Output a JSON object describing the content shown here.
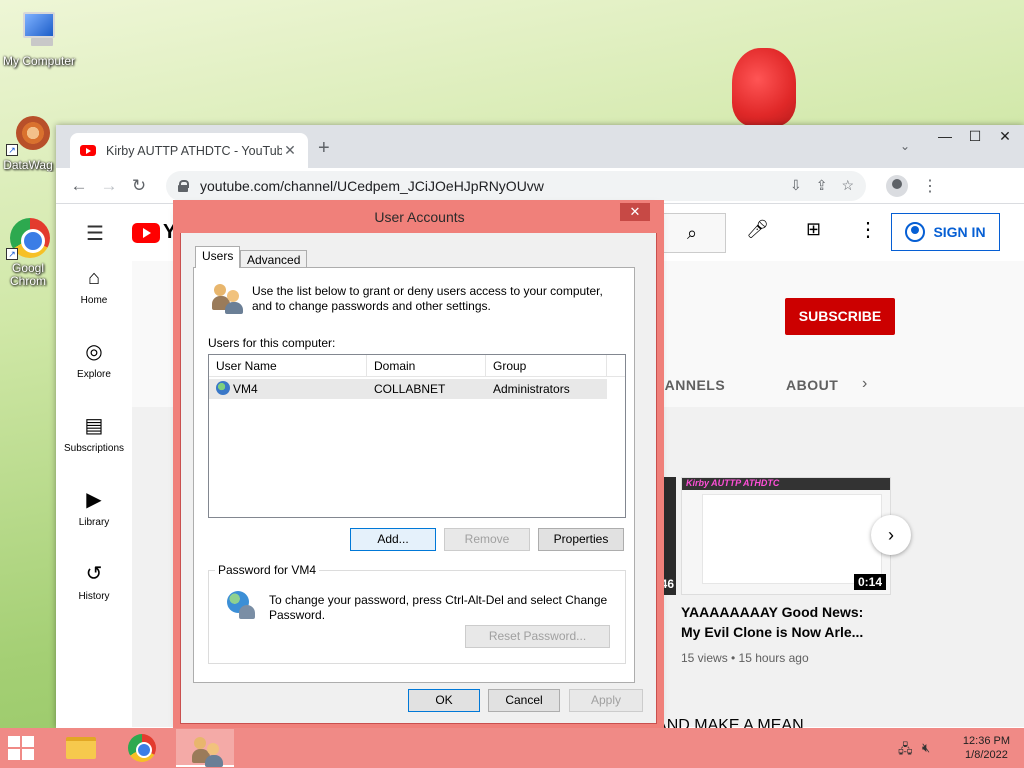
{
  "desktop": {
    "icons": [
      {
        "label": "My Computer"
      },
      {
        "label": "DataWag"
      },
      {
        "label": "Googl Chrom"
      }
    ]
  },
  "browser": {
    "tab_title": "Kirby AUTTP ATHDTC - YouTube",
    "url": "youtube.com/channel/UCedpem_JCiJOeHJpRNyOUvw",
    "newtab_glyph": "+",
    "window_controls": {
      "minimize": "—",
      "maximize": "☐",
      "close": "✕"
    }
  },
  "youtube": {
    "logo_text": "Yo",
    "sign_in": "SIGN IN",
    "subscribe": "SUBSCRIBE",
    "sidebar": [
      {
        "label": "Home",
        "icon": "⌂"
      },
      {
        "label": "Explore",
        "icon": "◎"
      },
      {
        "label": "Subscriptions",
        "icon": "▤"
      },
      {
        "label": "Library",
        "icon": "▶"
      },
      {
        "label": "History",
        "icon": "↺"
      }
    ],
    "channel_tabs": {
      "channels": "HANNELS",
      "about": "ABOUT"
    },
    "video": {
      "thumb_title": "Kirby AUTTP ATHDTC",
      "duration": "0:14",
      "prev_duration": "46",
      "title": "YAAAAAAAAY Good News: My Evil Clone is Now Arle...",
      "meta": "15 views • 15 hours ago"
    },
    "bottom_title": "BAD USER FOR MAKING BAD VIDEO OUT OF AUTTP AND MAKE A MEAN"
  },
  "dialog": {
    "title": "User Accounts",
    "tabs": {
      "users": "Users",
      "advanced": "Advanced"
    },
    "intro": "Use the list below to grant or deny users access to your computer, and to change passwords and other settings.",
    "users_label": "Users for this computer:",
    "columns": [
      "User Name",
      "Domain",
      "Group"
    ],
    "rows": [
      {
        "user": "VM4",
        "domain": "COLLABNET",
        "group": "Administrators"
      }
    ],
    "buttons": {
      "add": "Add...",
      "remove": "Remove",
      "properties": "Properties"
    },
    "password_group": "Password for VM4",
    "password_text": "To change your password, press Ctrl-Alt-Del and select Change Password.",
    "reset_password": "Reset Password...",
    "footer": {
      "ok": "OK",
      "cancel": "Cancel",
      "apply": "Apply"
    }
  },
  "taskbar": {
    "time": "12:36 PM",
    "date": "1/8/2022"
  }
}
